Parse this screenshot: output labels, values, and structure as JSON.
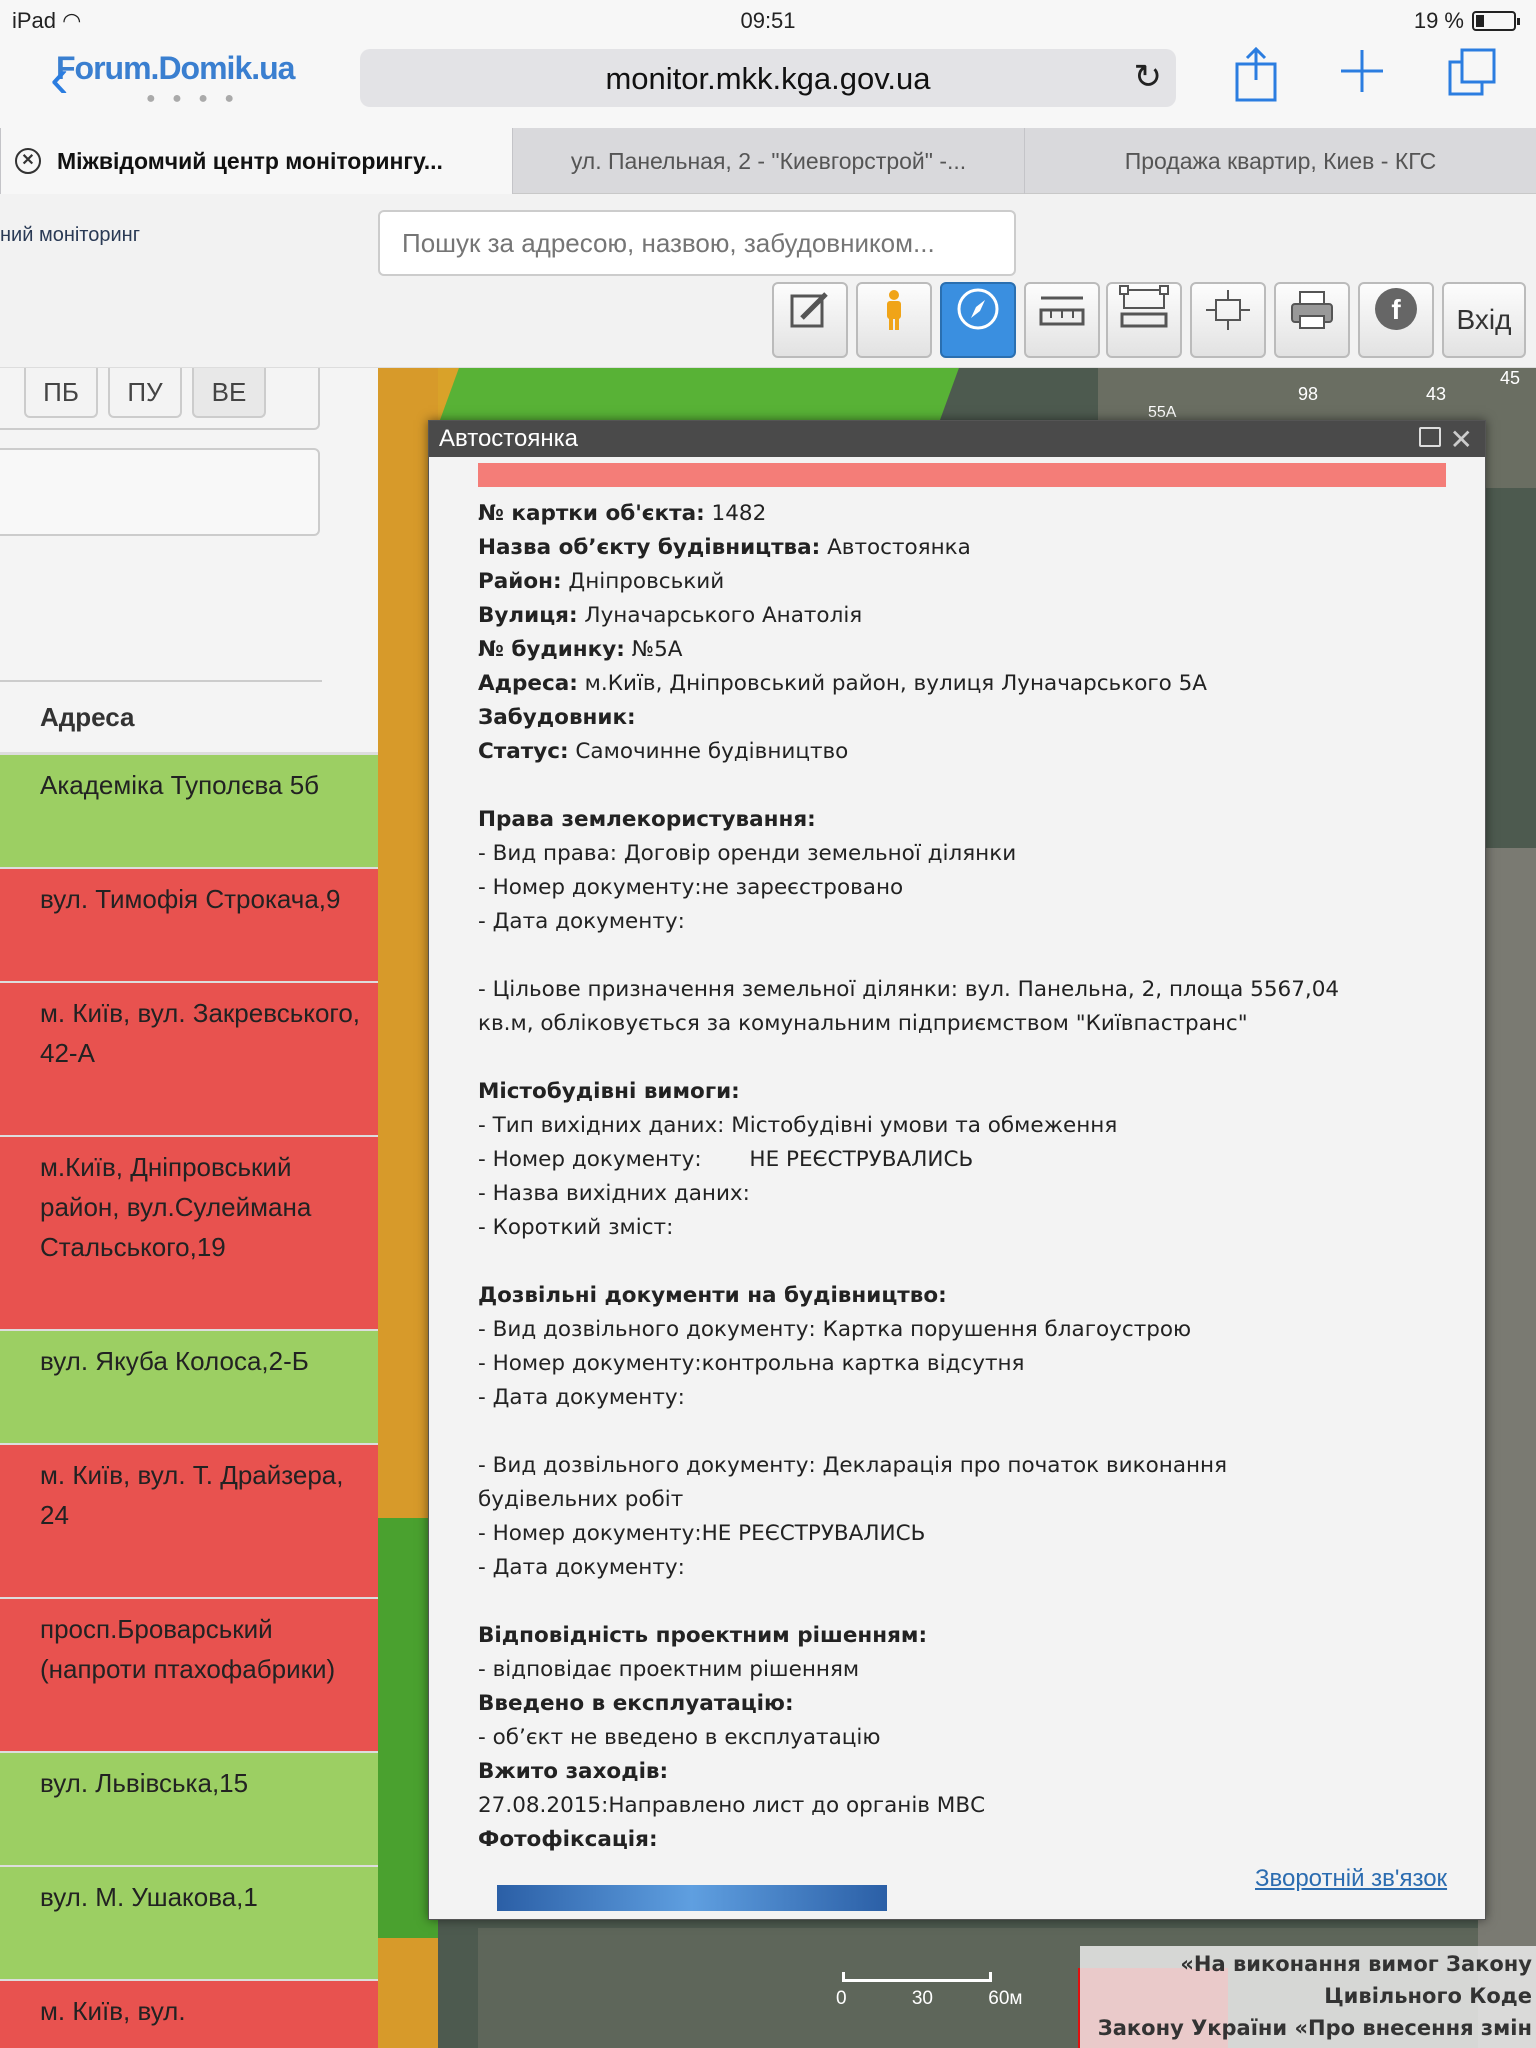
{
  "status_bar": {
    "device": "iPad",
    "time": "09:51",
    "battery": "19 %"
  },
  "browser": {
    "logo_text": "Forum.Domik.ua",
    "url": "monitor.mkk.kga.gov.ua",
    "tabs": [
      {
        "title": "Міжвідомчий центр моніторингу..."
      },
      {
        "title": "ул. Панельная, 2 - \"Киевгорстрой\" -..."
      },
      {
        "title": "Продажа квартир, Киев - КГС"
      }
    ]
  },
  "header": {
    "site_title_fragment": "ний моніторинг",
    "search_placeholder": "Пошук за адресою, назвою, забудовником...",
    "login_label": "Вхід"
  },
  "filters": [
    "ПБ",
    "ПУ",
    "ВЕ"
  ],
  "list": {
    "header": "Адреса",
    "rows": [
      {
        "address": "Академіка Туполєва 5б",
        "status": "green"
      },
      {
        "address": "вул. Тимофія Строкача,9",
        "status": "red"
      },
      {
        "address": "м. Київ, вул. Закревського, 42-А",
        "status": "red"
      },
      {
        "address": "м.Київ, Дніпровський район, вул.Сулеймана Стальського,19",
        "status": "red"
      },
      {
        "address": "вул. Якуба Колоса,2-Б",
        "status": "green"
      },
      {
        "address": "м. Київ, вул. Т. Драйзера, 24",
        "status": "red"
      },
      {
        "address": "просп.Броварський (напроти птахофабрики)",
        "status": "red"
      },
      {
        "address": "вул. Львівська,15",
        "status": "green"
      },
      {
        "address": "вул. М. Ушакова,1",
        "status": "green"
      },
      {
        "address": "м. Київ, вул.",
        "status": "red"
      }
    ]
  },
  "map": {
    "labels": [
      "98",
      "43",
      "45",
      "55А"
    ],
    "scale": {
      "l0": "0",
      "l1": "30",
      "l2": "60м"
    },
    "notice": [
      "«На виконання вимог Закону",
      "Цивільного Коде",
      "Закону України «Про внесення змін"
    ]
  },
  "popup": {
    "title": "Автостоянка",
    "lines": [
      {
        "label": "№ картки об'єкта:",
        "value": " 1482"
      },
      {
        "label": "Назва об’єкту будівництва:",
        "value": " Автостоянка"
      },
      {
        "label": "Район:",
        "value": " Дніпровський"
      },
      {
        "label": "Вулиця:",
        "value": " Луначарського Анатолія"
      },
      {
        "label": "№ будинку:",
        "value": " №5А"
      },
      {
        "label": "Адреса:",
        "value": " м.Київ, Дніпровський район, вулиця Луначарського 5А"
      },
      {
        "label": "Забудовник:",
        "value": ""
      },
      {
        "label": "Статус:",
        "value": " Самочинне будівництво"
      },
      {
        "label": "",
        "value": ""
      },
      {
        "label": "Права землекористування:",
        "value": ""
      },
      {
        "label": "",
        "value": "- Вид права: Договір оренди земельної ділянки"
      },
      {
        "label": "",
        "value": "- Номер документу:не зареєстровано"
      },
      {
        "label": "",
        "value": "- Дата документу:"
      },
      {
        "label": "",
        "value": ""
      },
      {
        "label": "",
        "value": "- Цільове призначення земельної ділянки: вул. Панельна, 2, площа 5567,04"
      },
      {
        "label": "",
        "value": "кв.м, обліковується за комунальним підприємством \"Київпастранс\""
      },
      {
        "label": "",
        "value": ""
      },
      {
        "label": "Містобудівні вимоги:",
        "value": ""
      },
      {
        "label": "",
        "value": "- Тип вихідних даних: Містобудівні умови та обмеження"
      },
      {
        "label": "",
        "value": "- Номер документу:       НЕ РЕЄСТРУВАЛИСЬ"
      },
      {
        "label": "",
        "value": "- Назва вихідних даних:"
      },
      {
        "label": "",
        "value": "- Короткий зміст:"
      },
      {
        "label": "",
        "value": ""
      },
      {
        "label": "Дозвільні документи на будівництво:",
        "value": ""
      },
      {
        "label": "",
        "value": "- Вид дозвільного документу: Картка порушення благоустрою"
      },
      {
        "label": "",
        "value": "- Номер документу:контрольна картка відсутня"
      },
      {
        "label": "",
        "value": "- Дата документу:"
      },
      {
        "label": "",
        "value": ""
      },
      {
        "label": "",
        "value": "- Вид дозвільного документу: Декларація про початок виконання"
      },
      {
        "label": "",
        "value": "будівельних робіт"
      },
      {
        "label": "",
        "value": "- Номер документу:НЕ РЕЄСТРУВАЛИСЬ"
      },
      {
        "label": "",
        "value": "- Дата документу:"
      },
      {
        "label": "",
        "value": ""
      },
      {
        "label": "Відповідність проектним рішенням:",
        "value": ""
      },
      {
        "label": "",
        "value": "- відповідає проектним рішенням"
      },
      {
        "label": "Введено в експлуатацію:",
        "value": ""
      },
      {
        "label": "",
        "value": "- об’єкт не введено в експлуатацію"
      },
      {
        "label": "Вжито заходів:",
        "value": ""
      },
      {
        "label": "",
        "value": "27.08.2015:Направлено лист до органів МВС"
      },
      {
        "label": "Фотофіксація:",
        "value": ""
      }
    ],
    "feedback_link": "Зворотній зв'язок"
  },
  "colors": {
    "green_row": "#9ccf63",
    "red_row": "#e8524f",
    "accent": "#2b7de0",
    "popup_bar": "#f47d78"
  }
}
